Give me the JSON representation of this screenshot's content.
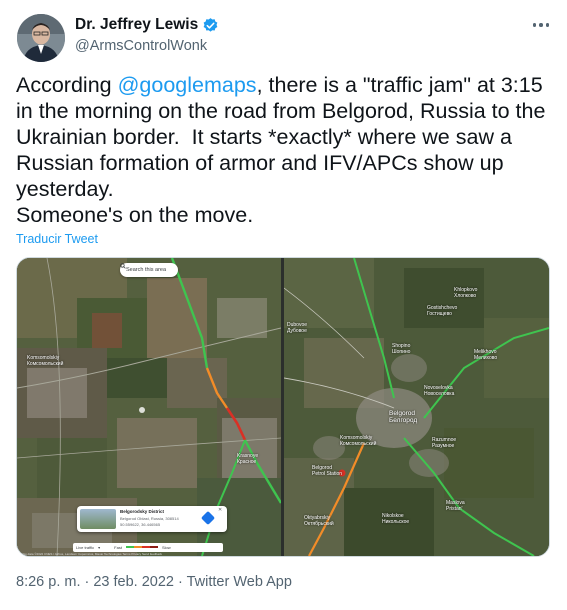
{
  "author": {
    "display_name": "Dr. Jeffrey Lewis",
    "handle": "@ArmsControlWonk"
  },
  "tweet": {
    "text_before": "According ",
    "mention": "@googlemaps",
    "text_after": ", there is a \"traffic jam\" at 3:15 in the morning on the road from Belgorod, Russia to the Ukrainian border.  It starts *exactly* where we saw a Russian formation of armor and IFV/APCs show up yesterday.\nSomeone's on the move.",
    "translate_label": "Traducir Tweet"
  },
  "left_map": {
    "search_label": "Search this area",
    "place_labels": [
      {
        "text": "Komsomolskiy\nКомсомольский",
        "kind": "town"
      },
      {
        "text": "Krasnoye\nКрасное",
        "kind": "town"
      }
    ],
    "info_card": {
      "title": "Belgorodsky District",
      "subtitle": "Belgorod Oblast, Russia, 308514",
      "coords": "50.559622, 36.446565"
    },
    "live_traffic": {
      "label": "Live traffic",
      "fast": "Fast",
      "slow": "Slow"
    },
    "attribution": "Map data ©2022 CNES / Airbus, Landsat / Copernicus, Maxar Technologies   Terms   Privacy   Send feedback"
  },
  "right_map": {
    "place_labels": [
      {
        "text": "Khlopkovo\nХлопково",
        "kind": "town"
      },
      {
        "text": "Gostishchevo\nГостищево",
        "kind": "town"
      },
      {
        "text": "Dubovoe\nДубовое",
        "kind": "town"
      },
      {
        "text": "Shopino\nШопино",
        "kind": "town"
      },
      {
        "text": "Melikhovo\nМелихово",
        "kind": "town"
      },
      {
        "text": "Novoselovka\nНовоселовка",
        "kind": "town"
      },
      {
        "text": "Belgorod\nБелгород",
        "kind": "city"
      },
      {
        "text": "Razumnoe\nРазумное",
        "kind": "town"
      },
      {
        "text": "Komsomolskiy\nКомсомольский",
        "kind": "town"
      },
      {
        "text": "Belgorod\nPetrol Station",
        "kind": "poi"
      },
      {
        "text": "Oktyabrskiy\nОктябрьский",
        "kind": "town"
      },
      {
        "text": "Nikolskoe\nНикольское",
        "kind": "town"
      },
      {
        "text": "Maslova\nPristan'",
        "kind": "town"
      }
    ]
  },
  "footer": {
    "timestamp": "8:26 p. m. · 23 feb. 2022 · Twitter Web App"
  },
  "colors": {
    "link_blue": "#1d9bf0",
    "text_primary": "#0f1419",
    "text_secondary": "#536471",
    "traffic_green": "#3fc44f",
    "traffic_orange": "#f28c28",
    "traffic_red": "#d93025"
  }
}
